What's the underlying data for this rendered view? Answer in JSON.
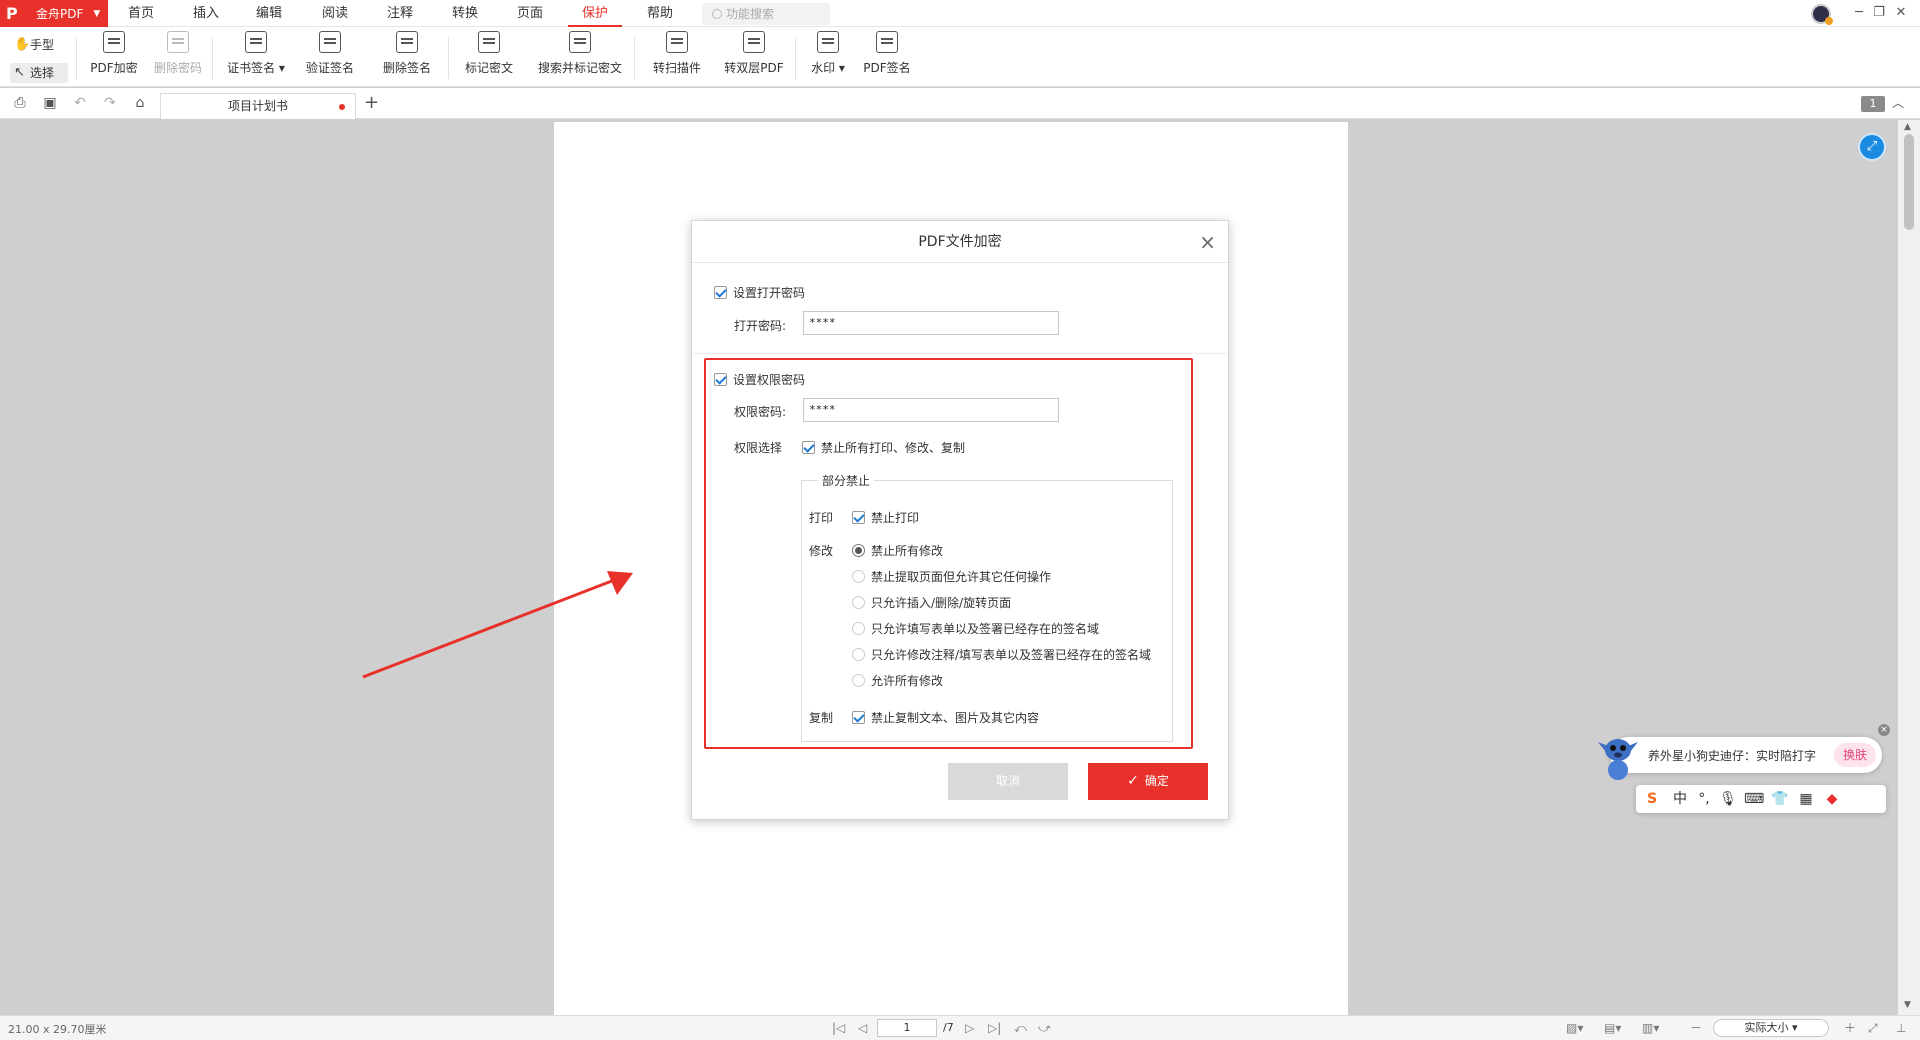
{
  "app": {
    "brand": "金舟PDF",
    "menu": [
      "首页",
      "插入",
      "编辑",
      "阅读",
      "注释",
      "转换",
      "页面",
      "保护",
      "帮助"
    ],
    "active_menu": "保护",
    "search_placeholder": "功能搜索"
  },
  "ribbon": {
    "modes": [
      "手型",
      "选择"
    ],
    "tools": [
      {
        "label": "PDF加密",
        "icon": "lock-icon",
        "enabled": true
      },
      {
        "label": "删除密码",
        "icon": "unlock-icon",
        "enabled": false
      },
      {
        "label": "证书签名",
        "icon": "certificate-icon",
        "enabled": true,
        "dropdown": true
      },
      {
        "label": "验证签名",
        "icon": "verify-signature-icon",
        "enabled": true
      },
      {
        "label": "删除签名",
        "icon": "delete-signature-icon",
        "enabled": true
      },
      {
        "label": "标记密文",
        "icon": "redact-mark-icon",
        "enabled": true
      },
      {
        "label": "搜索并标记密文",
        "icon": "search-redact-icon",
        "enabled": true
      },
      {
        "label": "转扫描件",
        "icon": "scan-convert-icon",
        "enabled": true
      },
      {
        "label": "转双层PDF",
        "icon": "dual-layer-icon",
        "enabled": true
      },
      {
        "label": "水印",
        "icon": "watermark-icon",
        "enabled": true,
        "dropdown": true
      },
      {
        "label": "PDF签名",
        "icon": "pen-sign-icon",
        "enabled": true
      }
    ]
  },
  "tabs": {
    "doc_title": "项目计划书",
    "modified": true,
    "page_badge": "1"
  },
  "dialog": {
    "title": "PDF文件加密",
    "open_pwd": {
      "checkbox_label": "设置打开密码",
      "checked": true,
      "field_label": "打开密码:",
      "value": "****"
    },
    "perm_pwd": {
      "checkbox_label": "设置权限密码",
      "checked": true,
      "field_label": "权限密码:",
      "value": "****"
    },
    "perm_choice_label": "权限选择",
    "forbid_all_label": "禁止所有打印、修改、复制",
    "partial_title": "部分禁止",
    "print_label": "打印",
    "forbid_print_label": "禁止打印",
    "modify_label": "修改",
    "modify_options": [
      {
        "label": "禁止所有修改",
        "selected": true
      },
      {
        "label": "禁止提取页面但允许其它任何操作",
        "selected": false
      },
      {
        "label": "只允许插入/删除/旋转页面",
        "selected": false
      },
      {
        "label": "只允许填写表单以及签署已经存在的签名域",
        "selected": false
      },
      {
        "label": "只允许修改注释/填写表单以及签署已经存在的签名域",
        "selected": false
      },
      {
        "label": "允许所有修改",
        "selected": false
      }
    ],
    "copy_label": "复制",
    "forbid_copy_label": "禁止复制文本、图片及其它内容",
    "cancel_label": "取消",
    "ok_label": "确定"
  },
  "status": {
    "page_size": "21.00 x 29.70厘米",
    "current_page": "1",
    "total_pages": "/7",
    "zoom": "实际大小"
  },
  "ime": {
    "bubble_text": "养外星小狗史迪仔：实时陪打字",
    "skin_label": "换肤",
    "lang_label": "中"
  },
  "colors": {
    "accent": "#e8312b",
    "highlight_box": "#e8312b",
    "float_button": "#1a8be0"
  }
}
